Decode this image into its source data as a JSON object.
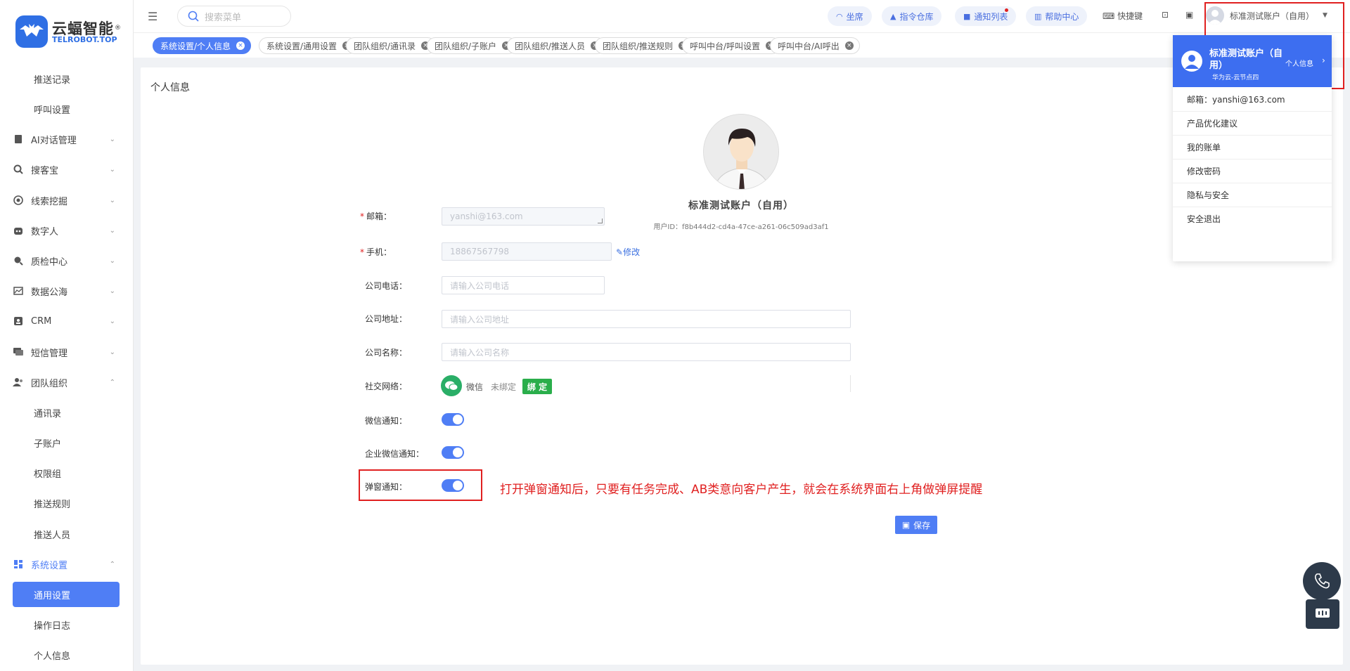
{
  "brand": {
    "name": "云蝠智能",
    "sub": "TELROBOT.TOP",
    "registered": "®"
  },
  "sidebar": {
    "items": [
      {
        "label": "推送记录"
      },
      {
        "label": "呼叫设置"
      },
      {
        "label": "AI对话管理"
      },
      {
        "label": "搜客宝"
      },
      {
        "label": "线索挖掘"
      },
      {
        "label": "数字人"
      },
      {
        "label": "质检中心"
      },
      {
        "label": "数据公海"
      },
      {
        "label": "CRM"
      },
      {
        "label": "短信管理"
      },
      {
        "label": "团队组织"
      },
      {
        "label": "通讯录"
      },
      {
        "label": "子账户"
      },
      {
        "label": "权限组"
      },
      {
        "label": "推送规则"
      },
      {
        "label": "推送人员"
      },
      {
        "label": "系统设置"
      },
      {
        "label": "通用设置"
      },
      {
        "label": "操作日志"
      },
      {
        "label": "个人信息"
      }
    ]
  },
  "header": {
    "search_placeholder": "搜索菜单",
    "pills": [
      {
        "label": "坐席"
      },
      {
        "label": "指令仓库"
      },
      {
        "label": "通知列表"
      },
      {
        "label": "帮助中心"
      }
    ],
    "shortcut_label": "快捷键",
    "account_name": "标准测试账户（自用）"
  },
  "tabs": [
    {
      "label": "系统设置/个人信息"
    },
    {
      "label": "系统设置/通用设置"
    },
    {
      "label": "团队组织/通讯录"
    },
    {
      "label": "团队组织/子账户"
    },
    {
      "label": "团队组织/推送人员"
    },
    {
      "label": "团队组织/推送规则"
    },
    {
      "label": "呼叫中台/呼叫设置"
    },
    {
      "label": "呼叫中台/AI呼出"
    }
  ],
  "profile": {
    "card_title": "个人信息",
    "name": "标准测试账户（自用）",
    "user_id": "用户ID：f8b444d2-cd4a-47ce-a261-06c509ad3af1",
    "email_label": "邮箱：",
    "email_value": "yanshi@163.com",
    "phone_label": "手机：",
    "phone_value": "18867567798",
    "edit_label": "修改",
    "company_phone_label": "公司电话：",
    "company_phone_placeholder": "请输入公司电话",
    "company_address_label": "公司地址：",
    "company_address_placeholder": "请输入公司地址",
    "company_name_label": "公司名称：",
    "company_name_placeholder": "请输入公司名称",
    "social_label": "社交网络：",
    "wechat_label": "微信",
    "wechat_status": "未绑定",
    "bind_label": "绑 定",
    "wechat_notify_label": "微信通知：",
    "wecom_notify_label": "企业微信通知：",
    "popup_notify_label": "弹窗通知：",
    "wechat_notify_on": true,
    "wecom_notify_on": true,
    "popup_notify_on": true,
    "save_label": "保存",
    "annotation": "打开弹窗通知后，只要有任务完成、AB类意向客户产生，就会在系统界面右上角做弹屏提醒"
  },
  "dropdown": {
    "name": "标准测试账户（自用）",
    "server": "华为云-云节点四",
    "personal_info": "个人信息",
    "email_line": "邮箱：yanshi@163.com",
    "items": [
      {
        "label": "产品优化建议"
      },
      {
        "label": "我的账单"
      },
      {
        "label": "修改密码"
      },
      {
        "label": "隐私与安全"
      },
      {
        "label": "安全退出"
      }
    ]
  },
  "colors": {
    "primary": "#4f7ef5",
    "annotation_red": "#e02020",
    "wechat_green": "#2aae4b"
  }
}
